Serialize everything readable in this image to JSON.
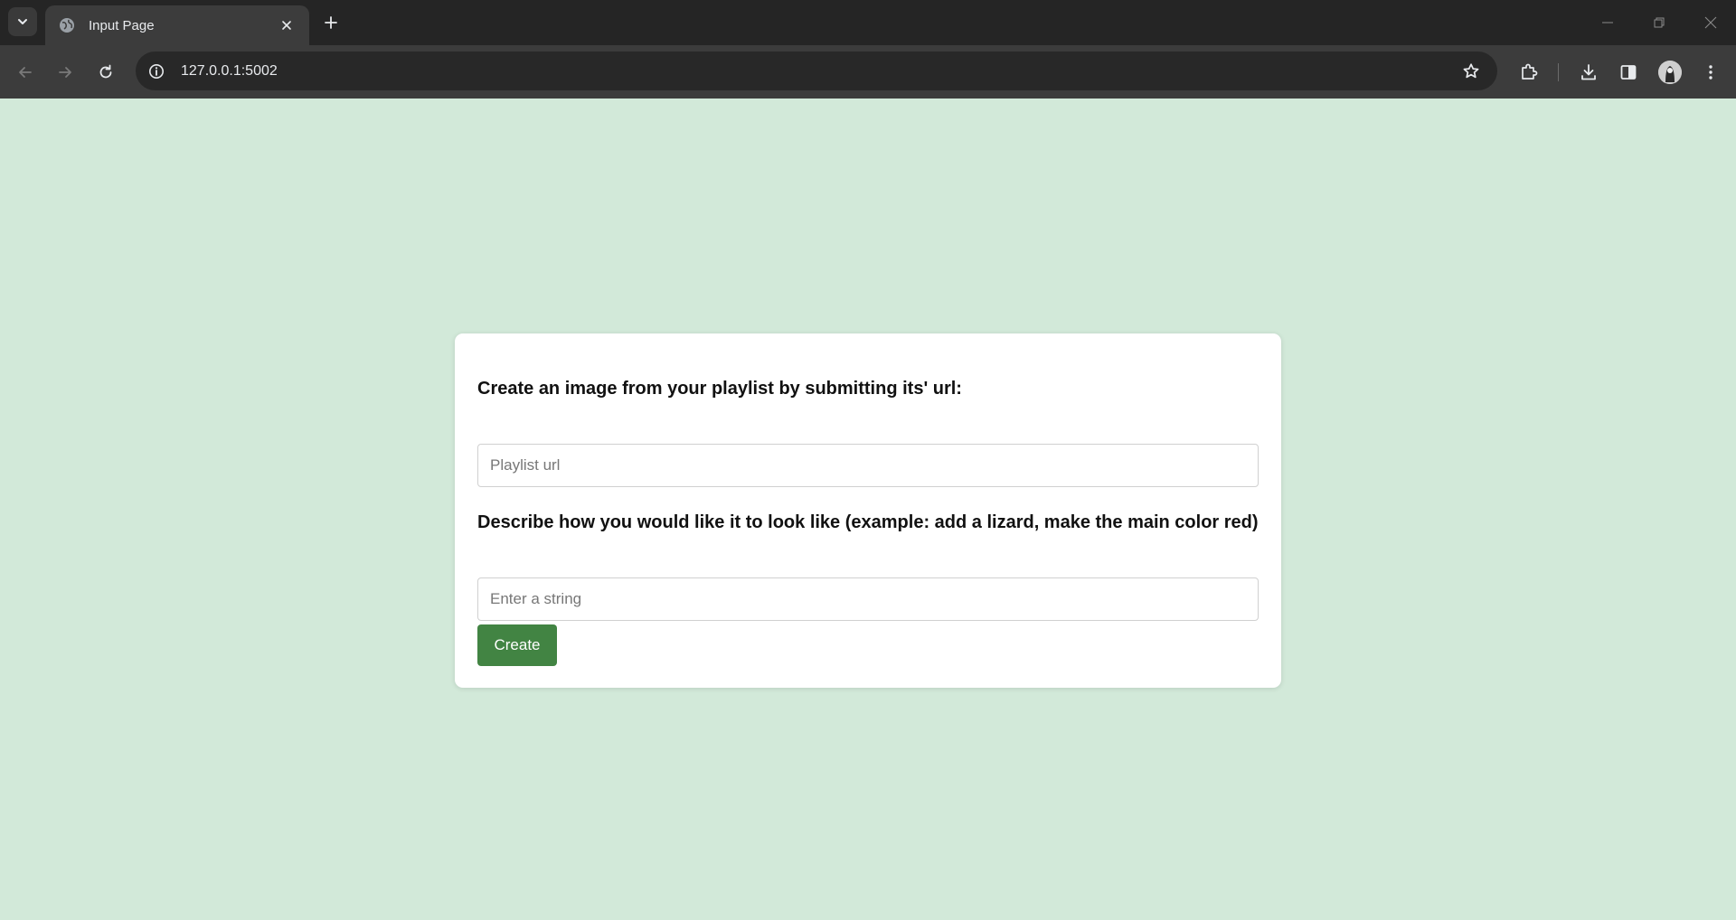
{
  "browser": {
    "tab_title": "Input Page",
    "url": "127.0.0.1:5002",
    "icons": {
      "tab_search": "chevron-down-icon",
      "favicon": "globe-icon",
      "tab_close": "close-icon",
      "new_tab": "plus-icon",
      "back": "arrow-left-icon",
      "forward": "arrow-right-icon",
      "reload": "reload-icon",
      "site_info": "info-icon",
      "bookmark": "star-icon",
      "extensions": "puzzle-icon",
      "downloads": "download-icon",
      "side_panel": "side-panel-icon",
      "profile": "avatar",
      "menu": "kebab-menu-icon"
    }
  },
  "form": {
    "playlist_label": "Create an image from your playlist by submitting its' url:",
    "playlist_placeholder": "Playlist url",
    "playlist_value": "",
    "describe_label": "Describe how you would like it to look like (example: add a lizard, make the main color red)",
    "describe_placeholder": "Enter a string",
    "describe_value": "",
    "submit_label": "Create"
  },
  "colors": {
    "page_background": "#d2e9d9",
    "card_background": "#ffffff",
    "button_green": "#428443",
    "chrome_dark": "#252525",
    "toolbar": "#3c3c3c"
  }
}
